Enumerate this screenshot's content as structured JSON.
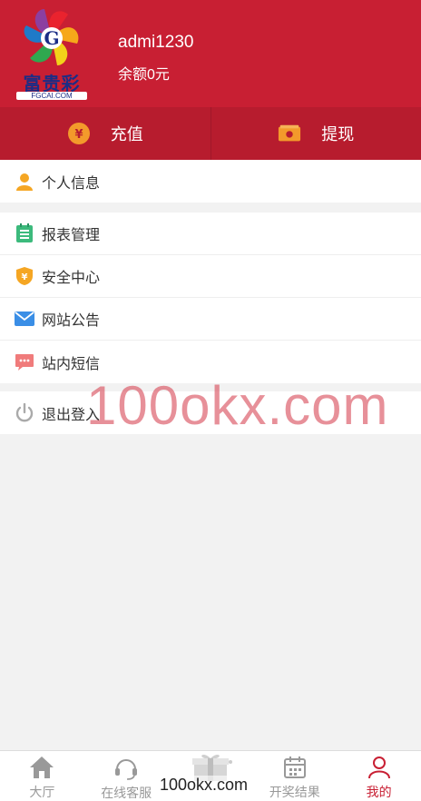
{
  "header": {
    "username": "admi1230",
    "balance": "余额0元",
    "logo_text": "富贵彩",
    "logo_sub": "FGCAI.COM"
  },
  "actions": {
    "recharge_label": "充值",
    "withdraw_label": "提现"
  },
  "menu": {
    "personal_info": "个人信息",
    "reports": "报表管理",
    "security": "安全中心",
    "announcements": "网站公告",
    "messages": "站内短信",
    "logout": "退出登入"
  },
  "watermark": "100okx.com",
  "tabs": [
    {
      "label": "大厅",
      "icon": "home-icon"
    },
    {
      "label": "在线客服",
      "icon": "headset-icon"
    },
    {
      "label": "",
      "icon": "gift-icon"
    },
    {
      "label": "开奖结果",
      "icon": "calendar-icon"
    },
    {
      "label": "我的",
      "icon": "user-icon",
      "active": true
    }
  ],
  "footer_watermark": "100okx.com",
  "colors": {
    "brand_red": "#c81f33",
    "action_bar": "#b71c2e",
    "coin_orange": "#f39a2b"
  }
}
